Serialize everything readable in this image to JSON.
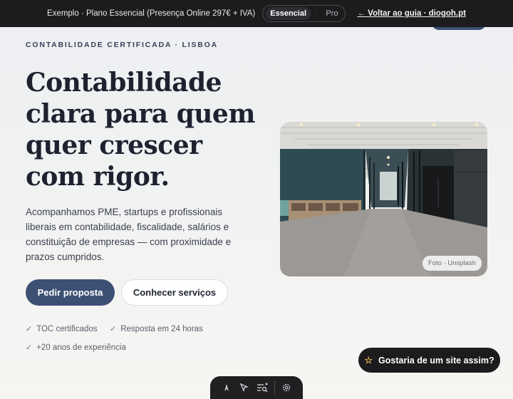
{
  "demo_bar": {
    "label": "Exemplo · Plano Essencial (Presença Online 297€ + IVA)",
    "plans": [
      {
        "label": "Essencial",
        "active": true
      },
      {
        "label": "Pro",
        "active": false
      }
    ],
    "separator": "·",
    "back_link": "← Voltar ao guia · diogoh.pt"
  },
  "hero": {
    "eyebrow": "CONTABILIDADE CERTIFICADA · LISBOA",
    "headline_lines": [
      "Contabilidade",
      "clara para quem",
      "quer crescer",
      "com rigor."
    ],
    "lead": "Acompanhamos PME, startups e profissionais liberais em contabilidade, fiscalidade, salários e constituição de empresas — com proximidade e prazos cumpridos.",
    "primary_button": "Pedir proposta",
    "secondary_button": "Conhecer serviços",
    "features": [
      {
        "check": "✓",
        "label": "TOC certificados"
      },
      {
        "check": "✓",
        "label": "Resposta em 24 horas"
      },
      {
        "check": "✓",
        "label": "+20 anos de experiência"
      }
    ],
    "photo_credit": "Foto · Unsplash"
  },
  "floating_cta": {
    "icon": "star-icon",
    "label": "Gostaria de um site assim?"
  },
  "toolbar": {
    "icons": [
      "astro-logo-icon",
      "pointer-inspect-icon",
      "audit-icon",
      "settings-icon"
    ]
  },
  "colors": {
    "primary": "#3d5073",
    "dark": "#1c1c1e",
    "accent_star": "#e2b650"
  }
}
